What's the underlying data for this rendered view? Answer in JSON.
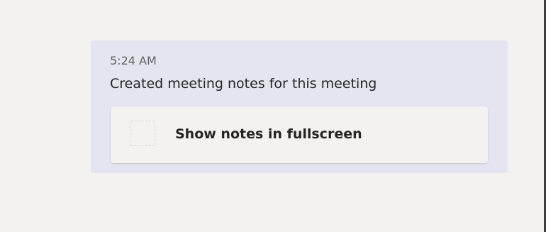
{
  "message": {
    "timestamp": "5:24 AM",
    "text": "Created meeting notes for this meeting",
    "card": {
      "label": "Show notes in fullscreen",
      "icon": "placeholder-icon"
    }
  },
  "colors": {
    "background": "#f3f2f1",
    "bubble": "#e5e5f1",
    "card": "#f3f2f1",
    "text": "#252423",
    "timestamp": "#616161"
  }
}
